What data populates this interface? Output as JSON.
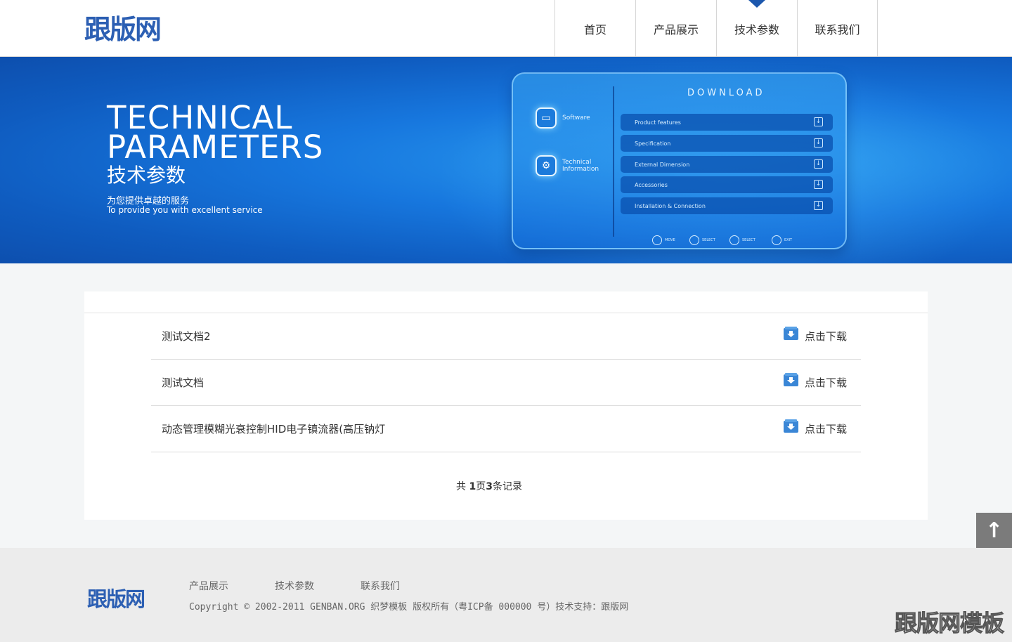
{
  "header": {
    "logo": "跟版网",
    "nav": [
      {
        "label": "首页",
        "active": false
      },
      {
        "label": "产品展示",
        "active": false
      },
      {
        "label": "技术参数",
        "active": true
      },
      {
        "label": "联系我们",
        "active": false
      }
    ]
  },
  "banner": {
    "title_line1": "TECHNICAL",
    "title_line2": "PARAMETERS",
    "title_cn": "技术参数",
    "subtitle_cn": "为您提供卓越的服务",
    "subtitle_en": "To provide you with excellent service",
    "panel": {
      "heading": "DOWNLOAD",
      "side_items": [
        "Software",
        "Technical Information"
      ],
      "rows": [
        "Product features",
        "Specification",
        "External Dimension",
        "Accessories",
        "Installation & Connection"
      ],
      "controls": [
        "MOVE",
        "SELECT",
        "SELECT",
        "EXIT"
      ]
    }
  },
  "documents": {
    "download_label": "点击下载",
    "items": [
      {
        "title": "测试文档2"
      },
      {
        "title": "测试文档"
      },
      {
        "title": "动态管理模糊光衰控制HID电子镇流器(高压钠灯"
      }
    ]
  },
  "pager": {
    "prefix": "共 ",
    "pages": "1",
    "mid": "页",
    "count": "3",
    "suffix": "条记录"
  },
  "footer": {
    "logo": "跟版网",
    "links": [
      "产品展示",
      "技术参数",
      "联系我们"
    ],
    "copyright": "Copyright © 2002-2011 GENBAN.ORG 织梦模板 版权所有（粤ICP备 000000 号）技术支持：跟版网",
    "watermark": "跟版网模板"
  },
  "colors": {
    "brand": "#2c5fb3",
    "nav_active_marker": "#1c57ad",
    "download_icon": "#3a86d6"
  }
}
